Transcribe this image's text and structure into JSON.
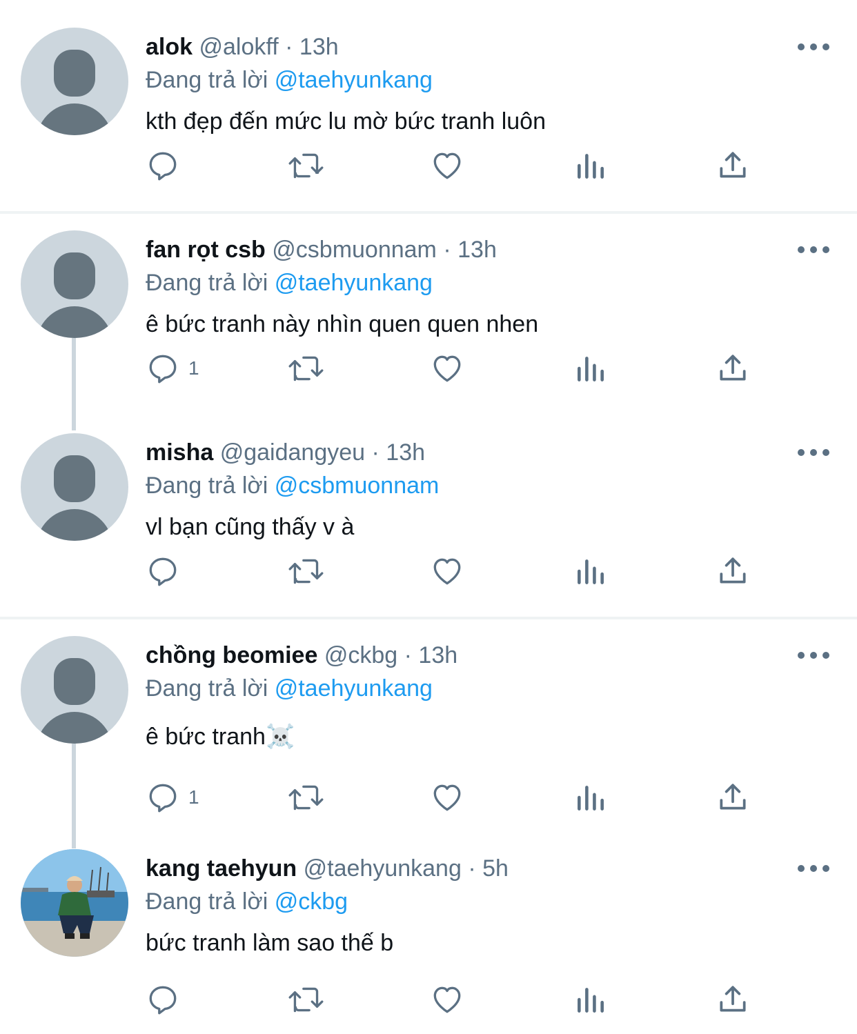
{
  "reply_prefix": "Đang trả lời",
  "tweets": [
    {
      "name": "alok",
      "handle": "@alokff",
      "time": "13h",
      "reply_to": "@taehyunkang",
      "text": "kth đẹp đến mức lu mờ bức tranh luôn",
      "reply_count": ""
    },
    {
      "name": "fan rọt csb",
      "handle": "@csbmuonnam",
      "time": "13h",
      "reply_to": "@taehyunkang",
      "text": "ê bức tranh này nhìn quen quen nhen",
      "reply_count": "1"
    },
    {
      "name": "misha",
      "handle": "@gaidangyeu",
      "time": "13h",
      "reply_to": "@csbmuonnam",
      "text": "vl bạn cũng thấy v à",
      "reply_count": ""
    },
    {
      "name": "chồng beomiee",
      "handle": "@ckbg",
      "time": "13h",
      "reply_to": "@taehyunkang",
      "text": "ê bức tranh☠️",
      "reply_count": "1"
    },
    {
      "name": "kang taehyun",
      "handle": "@taehyunkang",
      "time": "5h",
      "reply_to": "@ckbg",
      "text": "bức tranh làm sao thế b",
      "reply_count": ""
    }
  ],
  "separator": "·",
  "icons": {
    "reply": "reply-icon",
    "retweet": "retweet-icon",
    "like": "heart-icon",
    "stats": "analytics-icon",
    "share": "share-icon",
    "more": "more-icon"
  },
  "colors": {
    "mention": "#1d9bf0",
    "secondary_text": "#5b7083",
    "avatar_placeholder": "#ccd6dd",
    "avatar_silhouette": "#66757f"
  }
}
